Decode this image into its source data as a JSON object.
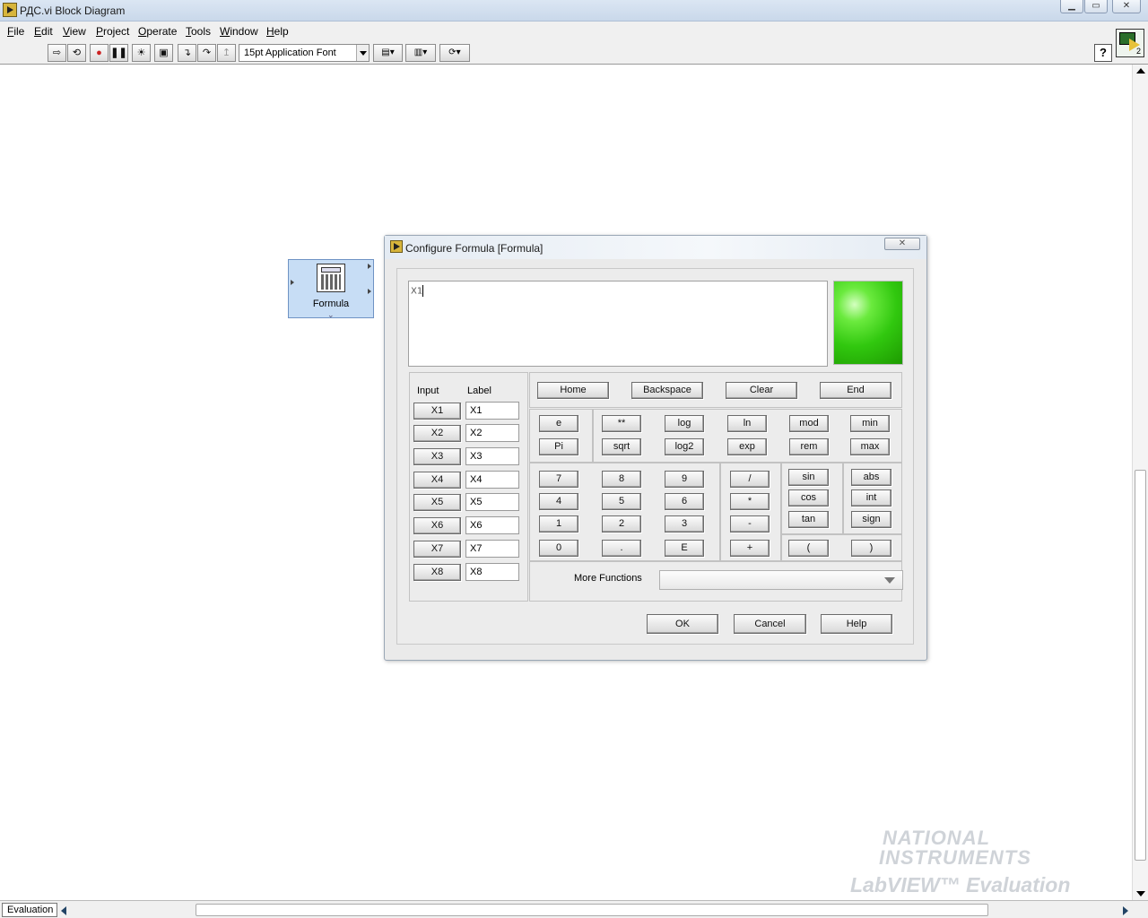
{
  "window": {
    "title": "РДС.vi Block Diagram",
    "minimize": "▁",
    "maximize": "▭",
    "close": "✕"
  },
  "menu": [
    "File",
    "Edit",
    "View",
    "Project",
    "Operate",
    "Tools",
    "Window",
    "Help"
  ],
  "toolbar": {
    "font": "15pt Application Font",
    "help": "?",
    "vi_icon_number": "2"
  },
  "node": {
    "label": "Formula"
  },
  "dialog": {
    "title": "Configure Formula [Formula]",
    "close": "✕",
    "formula_text": "X1",
    "input_header": "Input",
    "label_header": "Label",
    "inputs": [
      "X1",
      "X2",
      "X3",
      "X4",
      "X5",
      "X6",
      "X7",
      "X8"
    ],
    "labels": [
      "X1",
      "X2",
      "X3",
      "X4",
      "X5",
      "X6",
      "X7",
      "X8"
    ],
    "nav_buttons": [
      "Home",
      "Backspace",
      "Clear",
      "End"
    ],
    "func_row1": [
      "e",
      "**",
      "log",
      "ln",
      "mod",
      "min"
    ],
    "func_row2": [
      "Pi",
      "sqrt",
      "log2",
      "exp",
      "rem",
      "max"
    ],
    "digits_row1": [
      "7",
      "8",
      "9"
    ],
    "digits_row2": [
      "4",
      "5",
      "6"
    ],
    "digits_row3": [
      "1",
      "2",
      "3"
    ],
    "digits_row4": [
      "0",
      ".",
      "E"
    ],
    "operators": [
      "/",
      "*",
      "-",
      "+"
    ],
    "trig": [
      "sin",
      "cos",
      "tan"
    ],
    "misc": [
      "abs",
      "int",
      "sign"
    ],
    "parens": [
      "(",
      ")"
    ],
    "more_functions_label": "More Functions",
    "more_functions_value": "",
    "ok": "OK",
    "cancel": "Cancel",
    "help": "Help",
    "status_color": "#31c80f"
  },
  "statusbar": {
    "mode": "Evaluation"
  },
  "watermark": {
    "line1": "NATIONAL",
    "line2": "INSTRUMENTS",
    "line3": "LabVIEW™ Evaluation Software"
  }
}
